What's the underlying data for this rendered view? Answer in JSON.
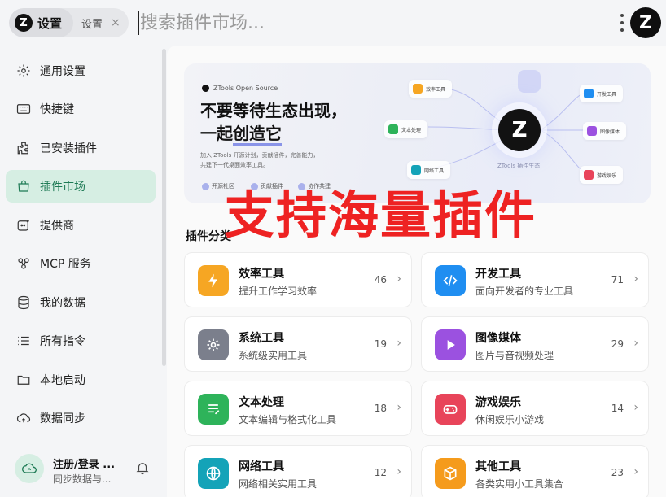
{
  "tabs": {
    "active": {
      "logo": "Z",
      "label": "设置"
    },
    "second": {
      "label": "设置",
      "close": "×"
    }
  },
  "search": {
    "placeholder": "搜索插件市场..."
  },
  "header": {
    "logo": "Z"
  },
  "sidebar": {
    "items": [
      {
        "label": "通用设置",
        "icon": "gear-icon"
      },
      {
        "label": "快捷键",
        "icon": "keyboard-icon"
      },
      {
        "label": "已安装插件",
        "icon": "puzzle-icon"
      },
      {
        "label": "插件市场",
        "icon": "store-icon",
        "active": true
      },
      {
        "label": "提供商",
        "icon": "provider-icon"
      },
      {
        "label": "MCP 服务",
        "icon": "mcp-icon"
      },
      {
        "label": "我的数据",
        "icon": "database-icon"
      },
      {
        "label": "所有指令",
        "icon": "list-icon"
      },
      {
        "label": "本地启动",
        "icon": "folder-icon"
      },
      {
        "label": "数据同步",
        "icon": "cloud-sync-icon"
      }
    ]
  },
  "user": {
    "name": "注册/登录 ...",
    "sub": "同步数据与..."
  },
  "banner": {
    "brand": "ZTools Open Source",
    "headline1": "不要等待生态出现，",
    "headline2_prefix": "一起",
    "headline2_emph": "创造它",
    "desc1": "加入 ZTools 开源计划，贡献插件，完善能力，",
    "desc2": "共建下一代桌面效率工具。",
    "chips": [
      "开源社区",
      "贡献插件",
      "协作共建"
    ],
    "hub_label": "ZTools 插件生态",
    "nodes": [
      "效率工具",
      "开发工具",
      "文本处理",
      "图像媒体",
      "网络工具",
      "游戏娱乐"
    ]
  },
  "overlay": "支持海量插件",
  "section": {
    "title": "插件分类"
  },
  "categories": [
    {
      "title": "效率工具",
      "sub": "提升工作学习效率",
      "count": "46",
      "color": "#f6a623",
      "icon": "lightning-icon"
    },
    {
      "title": "开发工具",
      "sub": "面向开发者的专业工具",
      "count": "71",
      "color": "#1f8ef1",
      "icon": "code-icon"
    },
    {
      "title": "系统工具",
      "sub": "系统级实用工具",
      "count": "19",
      "color": "#7b7f8c",
      "icon": "gear-icon"
    },
    {
      "title": "图像媒体",
      "sub": "图片与音视频处理",
      "count": "29",
      "color": "#9b51e0",
      "icon": "play-icon"
    },
    {
      "title": "文本处理",
      "sub": "文本编辑与格式化工具",
      "count": "18",
      "color": "#2eb35a",
      "icon": "text-icon"
    },
    {
      "title": "游戏娱乐",
      "sub": "休闲娱乐小游戏",
      "count": "14",
      "color": "#e8445a",
      "icon": "gamepad-icon"
    },
    {
      "title": "网络工具",
      "sub": "网络相关实用工具",
      "count": "12",
      "color": "#14a3b8",
      "icon": "globe-icon"
    },
    {
      "title": "其他工具",
      "sub": "各类实用小工具集合",
      "count": "23",
      "color": "#f59b1c",
      "icon": "box-icon"
    }
  ]
}
